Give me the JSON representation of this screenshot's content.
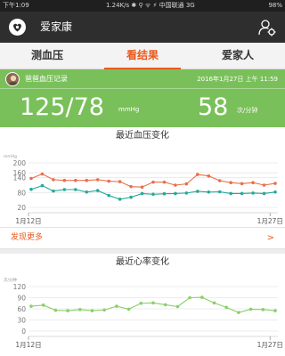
{
  "status_bar": {
    "time": "下午1:09",
    "network": "1.24K/s ✱ ⚲ ᯤ ⚡ 中国联通 3G",
    "battery": "98%"
  },
  "app": {
    "title": "爱家康"
  },
  "tabs": [
    {
      "label": "测血压",
      "active": false
    },
    {
      "label": "看结果",
      "active": true
    },
    {
      "label": "爱家人",
      "active": false
    }
  ],
  "record": {
    "title": "爸爸血压记录",
    "time": "2016年1月27日 上午 11:59",
    "bp_value": "125/78",
    "bp_unit": "mmHg",
    "heart_rate": "58",
    "heart_rate_unit": "次/分钟"
  },
  "discover_more": {
    "label": "发现更多",
    "arrow": ">"
  },
  "colors": {
    "accent": "#ea5b1e",
    "panel_green": "#7ac05a",
    "systolic": "#e8704b",
    "diastolic": "#26a99a",
    "heart_rate": "#8bcf6b"
  },
  "chart_data": [
    {
      "type": "line",
      "title": "最近血压变化",
      "ylabel": "mmHg",
      "ylim": [
        20,
        200
      ],
      "yticks": [
        200,
        160,
        140,
        80,
        20
      ],
      "xtick_labels": [
        "1月12日",
        "1月27日"
      ],
      "x_range": [
        1,
        33
      ],
      "grid": true,
      "series": [
        {
          "values": [
            137,
            155,
            132,
            129,
            129,
            129,
            132,
            126,
            124,
            104,
            102,
            122,
            122,
            110,
            115,
            153,
            147,
            128,
            120,
            116,
            120,
            110,
            117
          ]
        },
        {
          "values": [
            93,
            108,
            86,
            92,
            92,
            82,
            88,
            68,
            53,
            61,
            76,
            73,
            75,
            76,
            78,
            85,
            82,
            83,
            76,
            76,
            78,
            76,
            82
          ]
        }
      ]
    },
    {
      "type": "line",
      "title": "最近心率变化",
      "ylabel": "次/分钟",
      "ylim": [
        0,
        120
      ],
      "yticks": [
        120,
        90,
        60,
        30,
        0
      ],
      "xtick_labels": [
        "1月12日",
        "1月27日"
      ],
      "x_range": [
        1,
        33
      ],
      "grid": true,
      "series": [
        {
          "values": [
            67,
            70,
            56,
            55,
            58,
            55,
            57,
            67,
            59,
            75,
            76,
            71,
            66,
            90,
            91,
            76,
            64,
            50,
            59,
            58,
            55
          ]
        }
      ]
    }
  ]
}
